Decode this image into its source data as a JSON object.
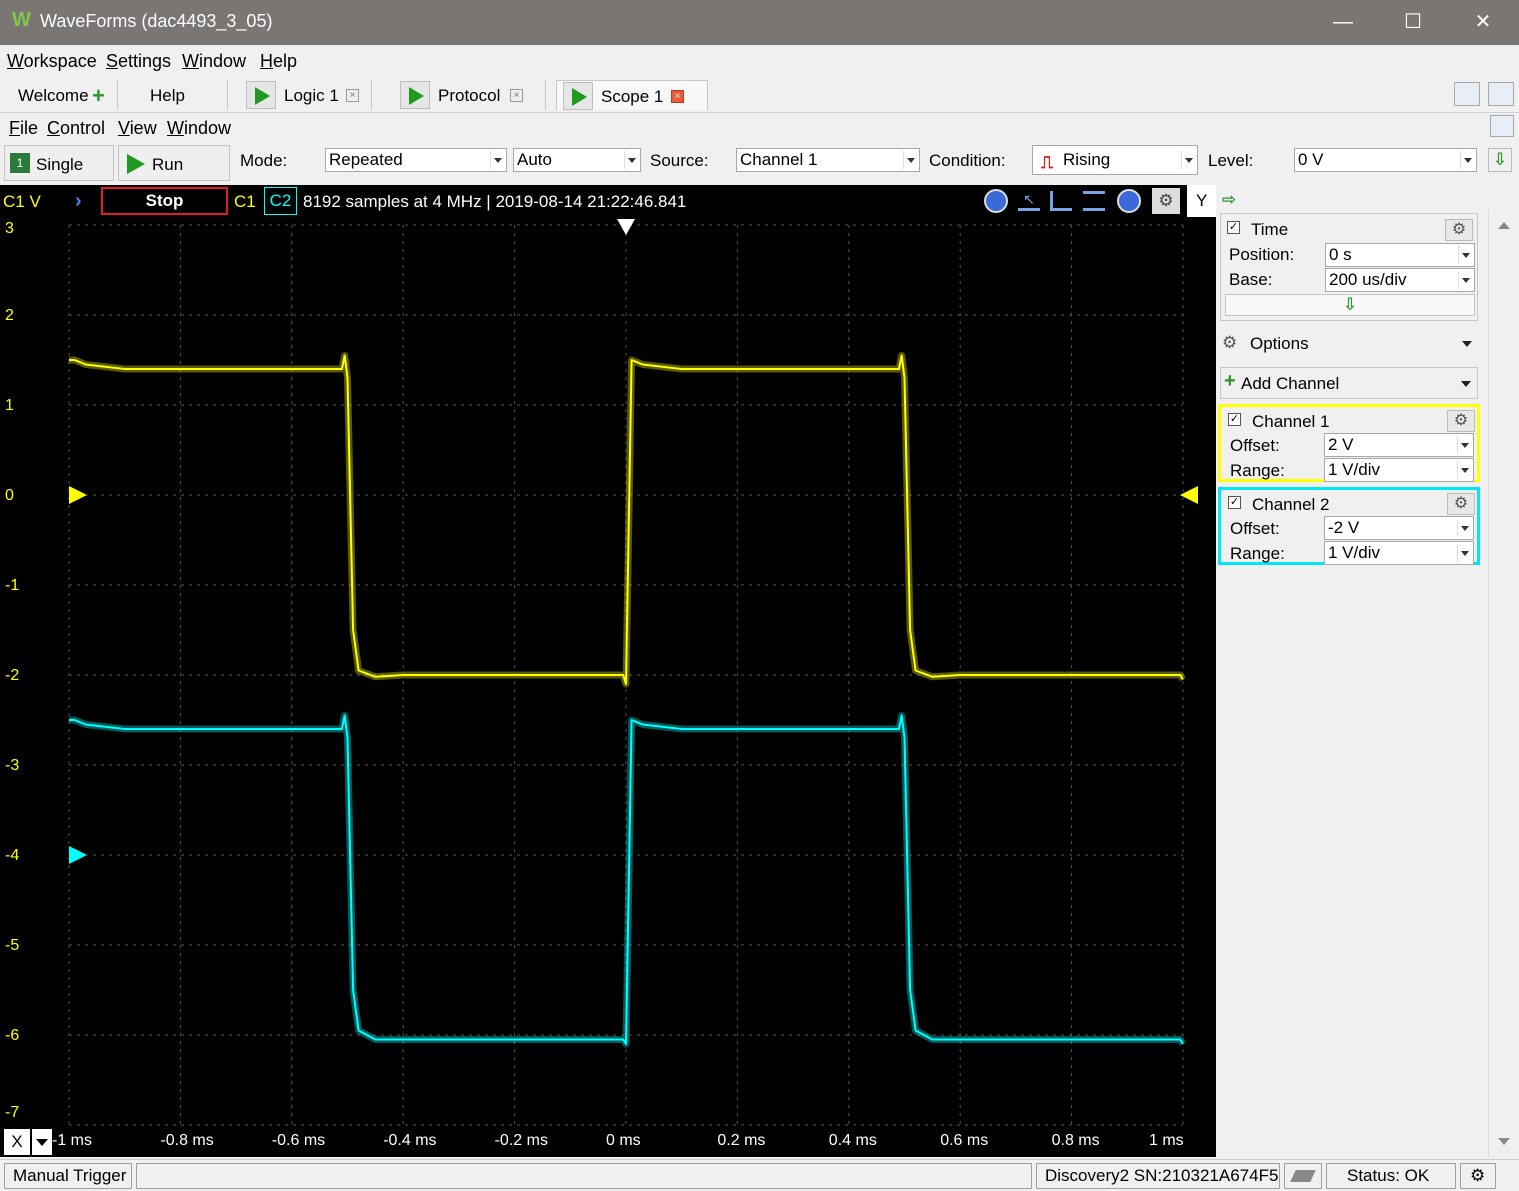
{
  "window": {
    "title": "WaveForms (dac4493_3_05)",
    "minimize": "—",
    "maximize": "☐",
    "close": "✕"
  },
  "main_menu": [
    "Workspace",
    "Settings",
    "Window",
    "Help"
  ],
  "tabs": {
    "welcome": "Welcome",
    "help": "Help",
    "logic": "Logic 1",
    "protocol": "Protocol",
    "scope": "Scope 1"
  },
  "scope_menu": [
    "File",
    "Control",
    "View",
    "Window"
  ],
  "toolbar": {
    "single": "Single",
    "run": "Run",
    "mode_label": "Mode:",
    "mode_value": "Repeated",
    "auto_value": "Auto",
    "source_label": "Source:",
    "source_value": "Channel 1",
    "condition_label": "Condition:",
    "condition_value": "Rising",
    "level_label": "Level:",
    "level_value": "0 V"
  },
  "scope_header": {
    "unit": "C1 V",
    "stop": "Stop",
    "c1": "C1",
    "c2": "C2",
    "info": "8192 samples at 4 MHz | 2019-08-14 21:22:46.841",
    "y_label": "Y"
  },
  "x_selector": "X",
  "right_panel": {
    "time": {
      "label": "Time",
      "position_label": "Position:",
      "position_value": "0 s",
      "base_label": "Base:",
      "base_value": "200 us/div"
    },
    "options": "Options",
    "add_channel": "Add Channel",
    "channel1": {
      "label": "Channel 1",
      "offset_label": "Offset:",
      "offset_value": "2 V",
      "range_label": "Range:",
      "range_value": "1 V/div",
      "color": "#ffff00"
    },
    "channel2": {
      "label": "Channel 2",
      "offset_label": "Offset:",
      "offset_value": "-2 V",
      "range_label": "Range:",
      "range_value": "1 V/div",
      "color": "#00ffff"
    }
  },
  "status": {
    "manual_trigger": "Manual Trigger",
    "device": "Discovery2 SN:210321A674F5",
    "status": "Status: OK"
  },
  "chart_data": {
    "type": "line",
    "x_ticks": [
      "-1 ms",
      "-0.8 ms",
      "-0.6 ms",
      "-0.4 ms",
      "-0.2 ms",
      "0 ms",
      "0.2 ms",
      "0.4 ms",
      "0.6 ms",
      "0.8 ms",
      "1 ms"
    ],
    "y_ticks": [
      "3",
      "2",
      "1",
      "0",
      "-1",
      "-2",
      "-3",
      "-4",
      "-5",
      "-6",
      "-7"
    ],
    "xlim": [
      -1.0,
      1.0
    ],
    "ylim": [
      -7,
      3
    ],
    "grid": true,
    "series": [
      {
        "name": "C1",
        "color": "#ffff00",
        "x": [
          -1.0,
          -0.99,
          -0.97,
          -0.9,
          -0.51,
          -0.505,
          -0.5,
          -0.49,
          -0.48,
          -0.45,
          -0.4,
          -0.1,
          -0.005,
          0.0,
          0.01,
          0.03,
          0.1,
          0.49,
          0.495,
          0.5,
          0.51,
          0.52,
          0.55,
          0.6,
          0.9,
          0.995,
          1.0
        ],
        "y": [
          1.5,
          1.5,
          1.45,
          1.4,
          1.4,
          1.55,
          1.3,
          -1.5,
          -1.95,
          -2.02,
          -2.0,
          -2.0,
          -2.0,
          -2.1,
          1.5,
          1.45,
          1.4,
          1.4,
          1.55,
          1.3,
          -1.5,
          -1.95,
          -2.02,
          -2.0,
          -2.0,
          -2.0,
          -2.05
        ]
      },
      {
        "name": "C2",
        "color": "#00ffff",
        "x": [
          -1.0,
          -0.99,
          -0.97,
          -0.9,
          -0.51,
          -0.505,
          -0.5,
          -0.49,
          -0.48,
          -0.45,
          -0.4,
          -0.1,
          -0.005,
          0.0,
          0.01,
          0.03,
          0.1,
          0.49,
          0.495,
          0.5,
          0.51,
          0.52,
          0.55,
          0.6,
          0.9,
          0.995,
          1.0
        ],
        "y": [
          -2.5,
          -2.5,
          -2.55,
          -2.6,
          -2.6,
          -2.45,
          -2.7,
          -5.5,
          -5.95,
          -6.05,
          -6.05,
          -6.05,
          -6.05,
          -6.1,
          -2.5,
          -2.55,
          -2.6,
          -2.6,
          -2.45,
          -2.7,
          -5.5,
          -5.95,
          -6.05,
          -6.05,
          -6.05,
          -6.05,
          -6.1
        ]
      }
    ]
  }
}
